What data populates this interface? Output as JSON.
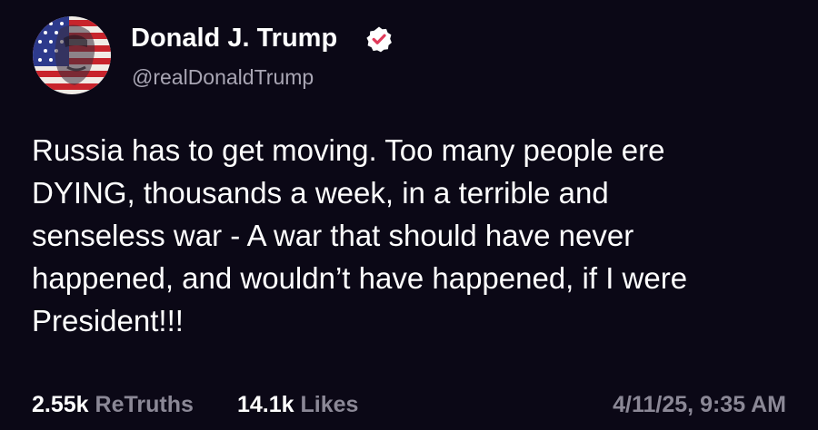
{
  "author": {
    "display_name": "Donald J. Trump",
    "handle": "@realDonaldTrump",
    "verified": true,
    "verified_color": "#ffffff",
    "avatar_icon": "flag-portrait-avatar"
  },
  "post": {
    "lines": [
      "Russia has to get moving. Too many people ere",
      "DYING, thousands a week, in a terrible and",
      "senseless war - A war that should have never",
      "happened, and wouldn’t have happened, if I were",
      "President!!!"
    ]
  },
  "stats": {
    "retruths_count": "2.55k",
    "retruths_label": "ReTruths",
    "likes_count": "14.1k",
    "likes_label": "Likes"
  },
  "timestamp": "4/11/25, 9:35 AM",
  "colors": {
    "background": "#0b0816",
    "text": "#ffffff",
    "muted": "#8b8896"
  }
}
